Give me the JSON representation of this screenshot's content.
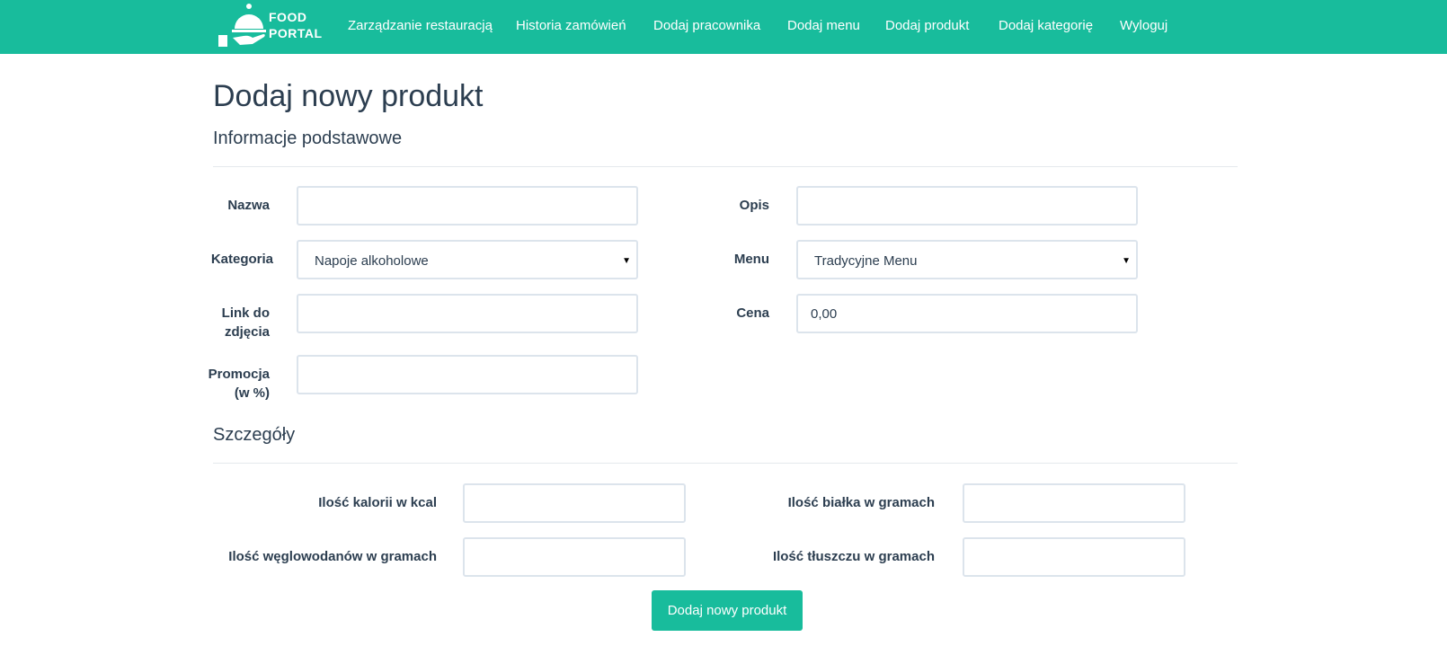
{
  "brand": {
    "line1": "FOOD",
    "line2": "PORTAL",
    "logo_icon": "cloche-hand-icon",
    "color": "#18bc9c"
  },
  "nav": [
    "Zarządzanie restauracją",
    "Historia zamówień",
    "Dodaj pracownika",
    "Dodaj menu",
    "Dodaj produkt",
    "Dodaj kategorię",
    "Wyloguj"
  ],
  "page": {
    "title": "Dodaj nowy produkt"
  },
  "basic": {
    "title": "Informacje podstawowe",
    "name_label": "Nazwa",
    "name_value": "",
    "desc_label": "Opis",
    "desc_value": "",
    "category_label": "Kategoria",
    "category_value": "Napoje alkoholowe",
    "menu_label": "Menu",
    "menu_value": "Tradycyjne Menu",
    "image_label_1": "Link do",
    "image_label_2": "zdjęcia",
    "image_value": "",
    "price_label": "Cena",
    "price_value": "0,00",
    "promo_label_1": "Promocja",
    "promo_label_2": "(w %)",
    "promo_value": ""
  },
  "details": {
    "title": "Szczegóły",
    "calories_label": "Ilość kalorii w kcal",
    "protein_label": "Ilość białka w gramach",
    "carbs_label": "Ilość węglowodanów w gramach",
    "fat_label": "Ilość tłuszczu w gramach"
  },
  "submit_label": "Dodaj nowy produkt"
}
